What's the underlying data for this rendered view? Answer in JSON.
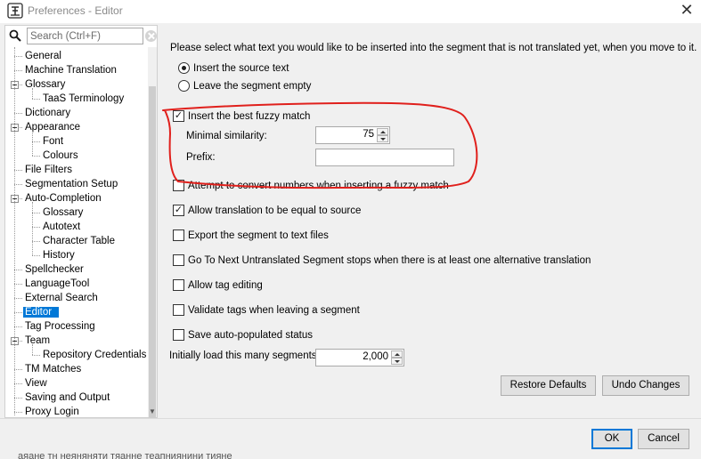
{
  "window": {
    "title": "Preferences - Editor",
    "close_glyph": "✕"
  },
  "search": {
    "placeholder": "Search (Ctrl+F)",
    "value": ""
  },
  "tree": {
    "items": [
      {
        "label": "General",
        "level": 0
      },
      {
        "label": "Machine Translation",
        "level": 0
      },
      {
        "label": "Glossary",
        "level": 0,
        "expandable": true
      },
      {
        "label": "TaaS Terminology",
        "level": 1
      },
      {
        "label": "Dictionary",
        "level": 0
      },
      {
        "label": "Appearance",
        "level": 0,
        "expandable": true
      },
      {
        "label": "Font",
        "level": 1
      },
      {
        "label": "Colours",
        "level": 1
      },
      {
        "label": "File Filters",
        "level": 0
      },
      {
        "label": "Segmentation Setup",
        "level": 0
      },
      {
        "label": "Auto-Completion",
        "level": 0,
        "expandable": true
      },
      {
        "label": "Glossary",
        "level": 1
      },
      {
        "label": "Autotext",
        "level": 1
      },
      {
        "label": "Character Table",
        "level": 1
      },
      {
        "label": "History",
        "level": 1
      },
      {
        "label": "Spellchecker",
        "level": 0
      },
      {
        "label": "LanguageTool",
        "level": 0
      },
      {
        "label": "External Search",
        "level": 0
      },
      {
        "label": "Editor",
        "level": 0,
        "selected": true
      },
      {
        "label": "Tag Processing",
        "level": 0
      },
      {
        "label": "Team",
        "level": 0,
        "expandable": true
      },
      {
        "label": "Repository Credentials",
        "level": 1
      },
      {
        "label": "TM Matches",
        "level": 0
      },
      {
        "label": "View",
        "level": 0
      },
      {
        "label": "Saving and Output",
        "level": 0
      },
      {
        "label": "Proxy Login",
        "level": 0
      }
    ]
  },
  "editor": {
    "intro": "Please select what text you would like to be inserted into the segment that is not translated yet, when you move to it.",
    "radio_source": "Insert the source text",
    "radio_empty": "Leave the segment empty",
    "radio_selected": "source",
    "fuzzy_label": "Insert the best fuzzy match",
    "fuzzy_checked": true,
    "min_similarity_label": "Minimal similarity:",
    "min_similarity_value": "75",
    "prefix_label": "Prefix:",
    "prefix_value": "",
    "options": [
      {
        "label": "Attempt to convert numbers when inserting a fuzzy match",
        "checked": false
      },
      {
        "label": "Allow translation to be equal to source",
        "checked": true
      },
      {
        "label": "Export the segment to text files",
        "checked": false
      },
      {
        "label": "Go To Next Untranslated Segment stops when there is at least one alternative translation",
        "checked": false
      },
      {
        "label": "Allow tag editing",
        "checked": false
      },
      {
        "label": "Validate tags when leaving a segment",
        "checked": false
      },
      {
        "label": "Save auto-populated status",
        "checked": false
      }
    ],
    "load_segments_label": "Initially load this many segments:",
    "load_segments_value": "2,000",
    "restore_defaults": "Restore Defaults",
    "undo_changes": "Undo Changes"
  },
  "footer": {
    "ok": "OK",
    "cancel": "Cancel",
    "behind_window_text": "аяане тн неяняняти тяанне теапниянини тияне"
  },
  "colors": {
    "selection": "#0078d7",
    "annotation_stroke": "#e0201c",
    "panel_bg": "#f0f0f0"
  },
  "icons": {
    "app": "omegat-icon",
    "search": "magnifier-icon",
    "clear": "clear-search-icon"
  }
}
